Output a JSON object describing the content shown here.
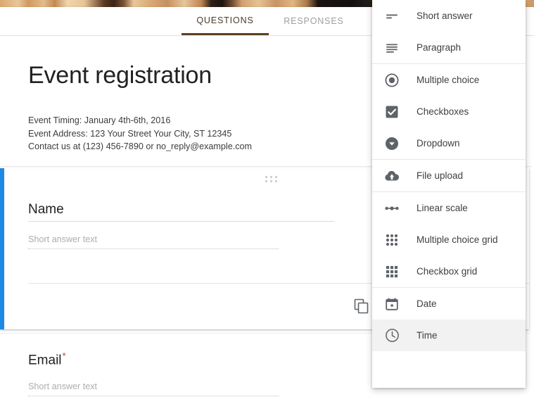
{
  "app": {
    "title": "Event registration",
    "accent_blue": "#1e88e5",
    "tab_active_color": "#5d4223",
    "required_color": "#c0392b"
  },
  "tabs": [
    {
      "label": "QUESTIONS",
      "active": true
    },
    {
      "label": "RESPONSES",
      "active": false
    }
  ],
  "form": {
    "title": "Event registration",
    "description_lines": [
      "Event Timing: January 4th-6th, 2016",
      "Event Address: 123 Your Street Your City, ST 12345",
      "Contact us at (123) 456-7890 or no_reply@example.com"
    ]
  },
  "questions": [
    {
      "title": "Name",
      "answer_placeholder": "Short answer text",
      "required": false,
      "selected": true,
      "drag_handle": "drag-handle-icon",
      "duplicate_icon": "duplicate-icon"
    },
    {
      "title": "Email",
      "required_marker": "*",
      "answer_placeholder": "Short answer text",
      "required": true,
      "selected": false
    }
  ],
  "question_type_menu": {
    "open": true,
    "hovered_item": "Time",
    "groups": [
      {
        "items": [
          {
            "label": "Short answer",
            "icon": "short-answer-icon"
          },
          {
            "label": "Paragraph",
            "icon": "paragraph-icon"
          }
        ]
      },
      {
        "items": [
          {
            "label": "Multiple choice",
            "icon": "radio-button-icon"
          },
          {
            "label": "Checkboxes",
            "icon": "checkbox-icon"
          },
          {
            "label": "Dropdown",
            "icon": "dropdown-circle-icon"
          }
        ]
      },
      {
        "items": [
          {
            "label": "File upload",
            "icon": "cloud-upload-icon"
          }
        ]
      },
      {
        "items": [
          {
            "label": "Linear scale",
            "icon": "linear-scale-icon"
          },
          {
            "label": "Multiple choice grid",
            "icon": "radio-grid-icon"
          },
          {
            "label": "Checkbox grid",
            "icon": "checkbox-grid-icon"
          }
        ]
      },
      {
        "items": [
          {
            "label": "Date",
            "icon": "calendar-icon"
          },
          {
            "label": "Time",
            "icon": "clock-icon"
          }
        ]
      }
    ]
  }
}
